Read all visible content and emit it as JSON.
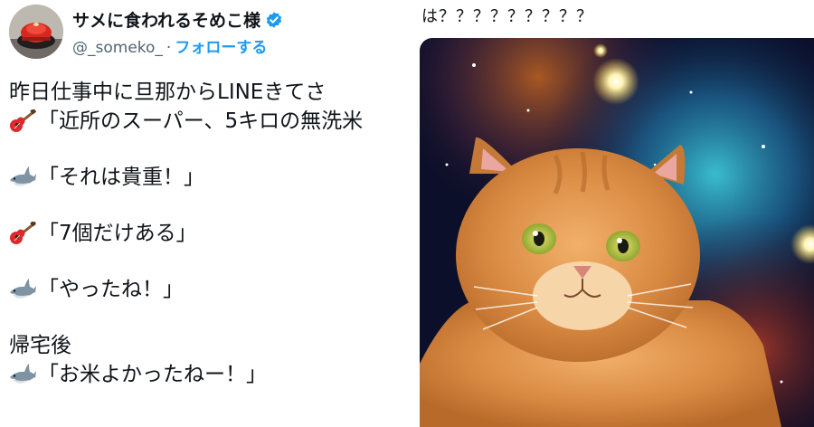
{
  "tweet": {
    "author": {
      "display_name": "サメに食われるそめこ様",
      "handle": "@_someko_",
      "separator": "·",
      "follow_label": "フォローする"
    },
    "icons": {
      "avatar": "avatar-image",
      "verified": "verified-badge-icon",
      "guitar": "guitar-emoji-icon",
      "shark": "shark-emoji-icon"
    },
    "lines": [
      "昨日仕事中に旦那からLINEきてさ",
      "「近所のスーパー、5キロの無洗米",
      "「それは貴重！」",
      "「7個だけある」",
      "「やったね！」",
      "帰宅後",
      "「お米よかったねー！」"
    ]
  },
  "reply": {
    "text": "は？？？？？？？？？"
  },
  "image": {
    "subject": "cat-in-space-image"
  },
  "colors": {
    "link": "#1d9bf0",
    "verified": "#1d9bf0",
    "text": "#0f1419",
    "muted": "#536471"
  }
}
